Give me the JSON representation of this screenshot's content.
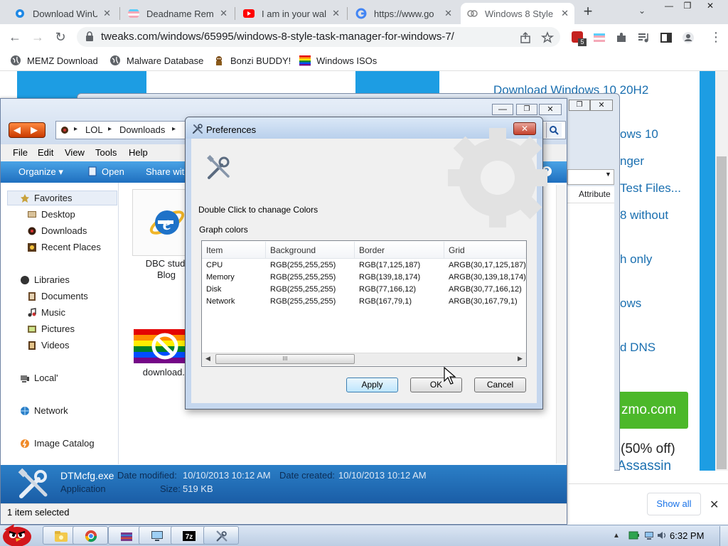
{
  "browser": {
    "tabs": [
      {
        "title": "Download WinU",
        "icon": "gear-favicon"
      },
      {
        "title": "Deadname Rem",
        "icon": "trans-flag-favicon"
      },
      {
        "title": "I am in your wal",
        "icon": "youtube-favicon"
      },
      {
        "title": "https://www.go",
        "icon": "google-favicon"
      },
      {
        "title": "Windows 8 Style",
        "icon": "site-favicon",
        "active": true
      }
    ],
    "new_tab": "+",
    "tab_search": "⌄",
    "window_controls": [
      "—",
      "❐",
      "✕"
    ],
    "url": "tweaks.com/windows/65995/windows-8-style-task-manager-for-windows-7/",
    "bookmarks": [
      {
        "label": "MEMZ Download",
        "icon": "globe-icon"
      },
      {
        "label": "Malware Database",
        "icon": "globe-icon"
      },
      {
        "label": "Bonzi BUDDY!",
        "icon": "bonzi-icon"
      },
      {
        "label": "Windows ISOs",
        "icon": "rainbow-flag-icon"
      }
    ],
    "extension_badge": "5"
  },
  "webpage": {
    "links": [
      "Download Windows 10 20H2",
      "ows 10",
      "nger",
      "Test Files...",
      "8 without",
      "h only",
      "ows",
      "d DNS"
    ],
    "green_button": "zmo.com",
    "sale_text": "(50% off)",
    "sale_text2": "Assassin",
    "show_all": "Show all",
    "close": "✕"
  },
  "explorer": {
    "breadcrumb": [
      "LOL",
      "Downloads"
    ],
    "menu": [
      "File",
      "Edit",
      "View",
      "Tools",
      "Help"
    ],
    "commands": [
      "Organize ▾",
      "Open",
      "Share with"
    ],
    "nav": {
      "favorites": "Favorites",
      "desktop": "Desktop",
      "downloads": "Downloads",
      "recent": "Recent Places",
      "libraries": "Libraries",
      "documents": "Documents",
      "music": "Music",
      "pictures": "Pictures",
      "videos": "Videos",
      "local": "Local'",
      "network": "Network",
      "image_catalog": "Image Catalog"
    },
    "files": [
      {
        "name_line1": "DBC studi",
        "name_line2": "Blog"
      },
      {
        "name_line1": "download.b",
        "name_line2": ""
      }
    ],
    "attribute_header": "Attribute",
    "details": {
      "filename": "DTMcfg.exe",
      "type": "Application",
      "modified_label": "Date modified:",
      "modified": "10/10/2013 10:12 AM",
      "created_label": "Date created:",
      "created": "10/10/2013 10:12 AM",
      "size_label": "Size:",
      "size": "519 KB"
    },
    "status": "1 item selected"
  },
  "dialog": {
    "title": "Preferences",
    "close": "✕",
    "hint": "Double Click to chanage Colors",
    "group_label": "Graph colors",
    "columns": [
      "Item",
      "Background",
      "Border",
      "Grid"
    ],
    "rows": [
      {
        "item": "CPU",
        "background": "RGB(255,255,255)",
        "border": "RGB(17,125,187)",
        "grid": "ARGB(30,17,125,187)"
      },
      {
        "item": "Memory",
        "background": "RGB(255,255,255)",
        "border": "RGB(139,18,174)",
        "grid": "ARGB(30,139,18,174)"
      },
      {
        "item": "Disk",
        "background": "RGB(255,255,255)",
        "border": "RGB(77,166,12)",
        "grid": "ARGB(30,77,166,12)"
      },
      {
        "item": "Network",
        "background": "RGB(255,255,255)",
        "border": "RGB(167,79,1)",
        "grid": "ARGB(30,167,79,1)"
      }
    ],
    "scroll_mark": "III",
    "buttons": {
      "apply": "Apply",
      "ok": "OK",
      "cancel": "Cancel"
    }
  },
  "taskbar": {
    "time": "6:32 PM",
    "items": [
      "explorer-icon",
      "chrome-icon",
      "winrar-icon",
      "monitor-icon",
      "7zip-icon",
      "tools-icon"
    ],
    "sevenzip_label": "7z"
  },
  "colors": {
    "accent_blue": "#1d9de3",
    "explorer_cmdbar": "#2f86d4",
    "green_button": "#4cb82a",
    "link": "#1a6fb0"
  }
}
